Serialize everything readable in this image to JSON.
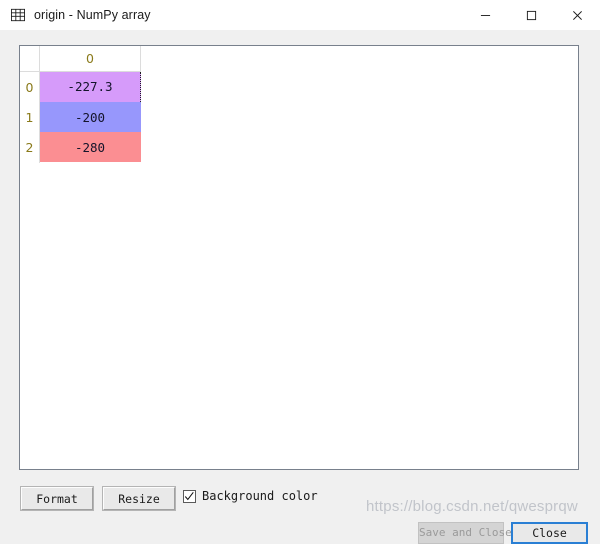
{
  "window": {
    "icon": "table-grid-icon",
    "title": "origin - NumPy array",
    "controls": {
      "minimize": "—",
      "maximize": "□",
      "close": "✕"
    }
  },
  "table": {
    "column_headers": [
      "0"
    ],
    "row_headers": [
      "0",
      "1",
      "2"
    ],
    "rows": [
      {
        "index": "0",
        "values": [
          "-227.3"
        ],
        "bg": "#d69bfa",
        "selected": true
      },
      {
        "index": "1",
        "values": [
          "-200"
        ],
        "bg": "#9797fc",
        "selected": false
      },
      {
        "index": "2",
        "values": [
          "-280"
        ],
        "bg": "#fb8e92",
        "selected": false
      }
    ]
  },
  "toolbar": {
    "format_label": "Format",
    "resize_label": "Resize",
    "background_color_label": "Background color",
    "background_color_checked": true,
    "checkmark": "✓"
  },
  "footer": {
    "save_and_close_label": "Save and Close",
    "close_label": "Close"
  },
  "watermark": {
    "text": "https://blog.csdn.net/qwesprqw"
  }
}
